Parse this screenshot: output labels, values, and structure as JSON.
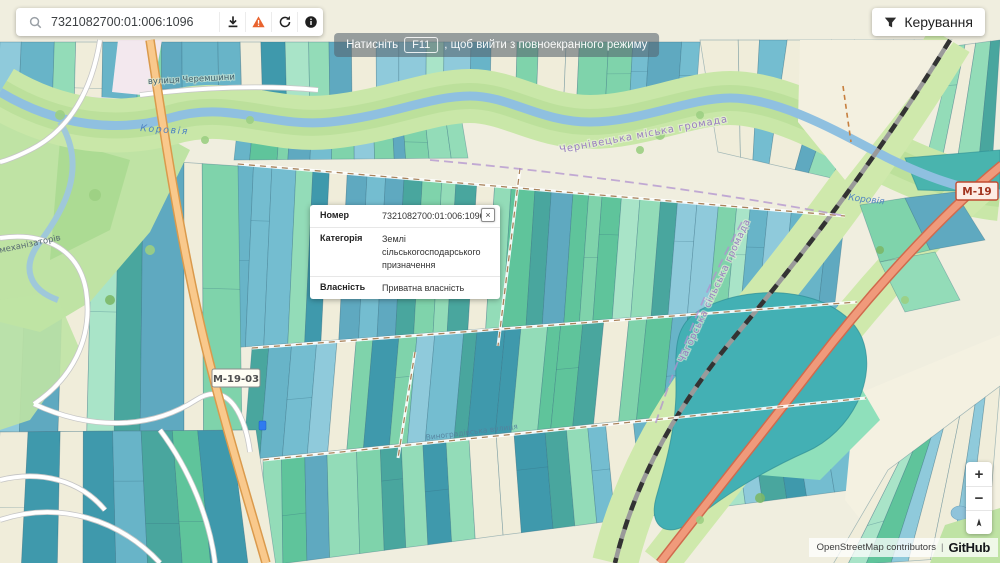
{
  "ui": {
    "search_bar": {
      "query": "7321082700:01:006:1096"
    },
    "manage_button": {
      "label": "Керування"
    },
    "fullscreen_toast": {
      "prefix": "Натисніть",
      "key": "F11",
      "suffix": ", щоб вийти з повноекранного режиму"
    },
    "parcel_popup": {
      "close_label": "×",
      "fields": [
        {
          "label": "Номер",
          "value": "7321082700:01:006:1096"
        },
        {
          "label": "Категорія",
          "value": "Землі сільськогосподарського призначення"
        },
        {
          "label": "Власність",
          "value": "Приватна власність"
        }
      ]
    },
    "zoom_control": {
      "zoom_in": "+",
      "zoom_out": "−"
    },
    "attribution": {
      "osm": "OpenStreetMap contributors",
      "separator": "|",
      "brand": "GitHub"
    }
  },
  "map": {
    "labels": {
      "street_cheremshyny": "вулиця Черемшини",
      "river_west": "Коровія",
      "river_east": "Коровія",
      "boundary_chernivtsi": "Чернівецька міська громада",
      "boundary_chahor": "Чагорська сільська громада",
      "street_mekhanizatoriv": "механізаторів",
      "street_vynohradivska": "Виноградівська вулиця",
      "road_badge_main": "М-19",
      "road_badge_secondary": "М-19-03"
    },
    "colors": {
      "parcel_blue": "#5fa9c0",
      "parcel_green": "#7fd3ab",
      "water": "#8fc0e0",
      "road_primary_fill": "#f09a7b",
      "road_secondary_fill": "#f9c98c",
      "greenbelt": "#cfe9ac",
      "warning_accent": "#e9632e"
    }
  }
}
